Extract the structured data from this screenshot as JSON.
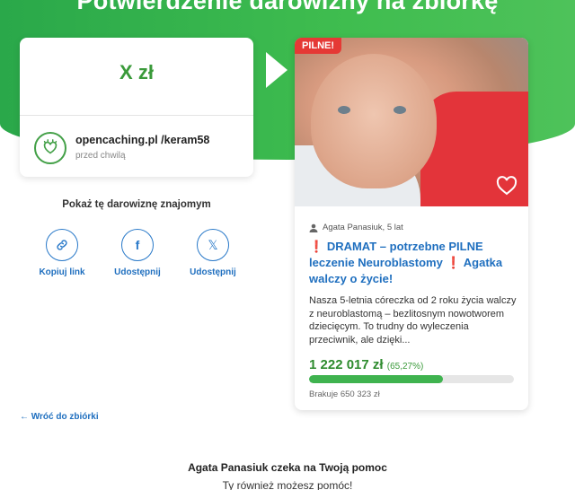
{
  "header": {
    "title": "Potwierdzenie darowizny na zbiórkę"
  },
  "donation": {
    "amount": "X zł",
    "donor_name": "opencaching.pl /keram58",
    "donor_time": "przed chwilą"
  },
  "share": {
    "title": "Pokaż tę darowiznę znajomym",
    "buttons": [
      {
        "label": "Kopiuj link",
        "icon": "link-icon"
      },
      {
        "label": "Udostępnij",
        "icon": "facebook-icon"
      },
      {
        "label": "Udostępnij",
        "icon": "x-icon"
      }
    ]
  },
  "back_link": "Wróć do zbiórki",
  "campaign": {
    "badge": "PILNE!",
    "author": "Agata Panasiuk, 5 lat",
    "title_part1": "DRAMAT – potrzebne PILNE leczenie Neuroblastomy",
    "title_part2": "Agatka walczy o życie!",
    "description": "Nasza 5-letnia córeczka od 2 roku życia walczy z neuroblastomą – bezlitosnym nowotworem dziecięcym. To trudny do wyleczenia przeciwnik, ale dzięki...",
    "raised": "1 222 017 zł",
    "percent": "(65,27%)",
    "progress": 0.6527,
    "missing": "Brakuje 650 323 zł"
  },
  "footer": {
    "line1": "Agata Panasiuk czeka na Twoją pomoc",
    "line2": "Ty również możesz pomóc!"
  },
  "colors": {
    "green": "#3fb34f",
    "blue": "#1f6fbf",
    "red": "#e53935"
  }
}
